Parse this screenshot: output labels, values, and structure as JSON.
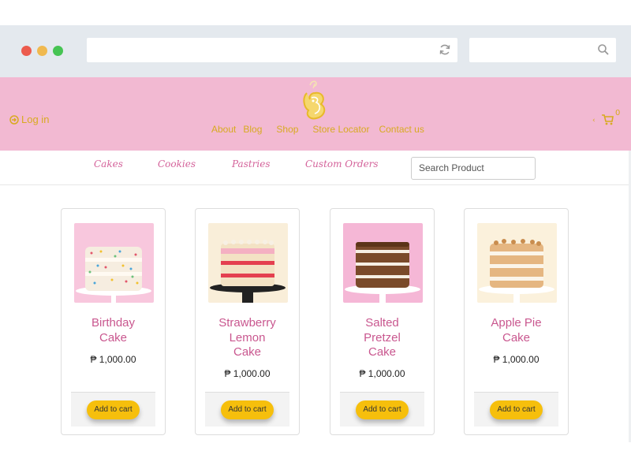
{
  "header": {
    "login_label": "Log in",
    "nav": [
      "About",
      "Blog",
      "Shop",
      "Store Locator",
      "Contact us"
    ],
    "cart_count": "0"
  },
  "categories": [
    "Cakes",
    "Cookies",
    "Pastries",
    "Custom Orders"
  ],
  "search": {
    "placeholder": "Search Product"
  },
  "products": [
    {
      "name": "Birthday Cake",
      "price": "₱ 1,000.00",
      "button": "Add to cart",
      "bg": "#f8c7dd"
    },
    {
      "name": "Strawberry Lemon Cake",
      "price": "₱ 1,000.00",
      "button": "Add to cart",
      "bg": "#f9eed9"
    },
    {
      "name": "Salted Pretzel Cake",
      "price": "₱ 1,000.00",
      "button": "Add to cart",
      "bg": "#f5b7d6"
    },
    {
      "name": "Apple Pie Cake",
      "price": "₱ 1,000.00",
      "button": "Add to cart",
      "bg": "#fbf1dc"
    }
  ],
  "colors": {
    "header_bg": "#f2b9d2",
    "accent_gold": "#d8aa20",
    "product_pink": "#c9578f",
    "button_yellow": "#f6bf0c"
  }
}
